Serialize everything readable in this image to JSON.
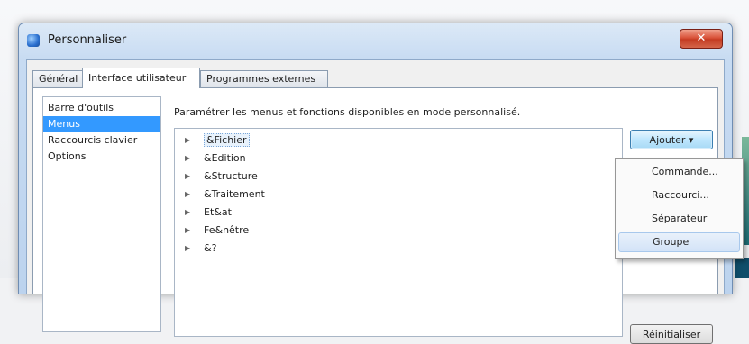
{
  "window": {
    "title": "Personnaliser",
    "close_label": "✕"
  },
  "tabs": [
    {
      "label": "Général"
    },
    {
      "label": "Interface utilisateur"
    },
    {
      "label": "Programmes externes"
    }
  ],
  "nav": {
    "items": [
      {
        "label": "Barre d'outils"
      },
      {
        "label": "Menus"
      },
      {
        "label": "Raccourcis clavier"
      },
      {
        "label": "Options"
      }
    ],
    "selected": "Menus"
  },
  "content": {
    "description": "Paramétrer les menus et fonctions disponibles en mode personnalisé.",
    "tree_items": [
      {
        "label": "&Fichier"
      },
      {
        "label": "&Edition"
      },
      {
        "label": "&Structure"
      },
      {
        "label": "&Traitement"
      },
      {
        "label": "Et&at"
      },
      {
        "label": "Fe&nêtre"
      },
      {
        "label": "&?"
      }
    ]
  },
  "buttons": {
    "add_label": "Ajouter ▾",
    "reset_label": "Réinitialiser"
  },
  "dropdown": {
    "items": [
      {
        "label": "Commande..."
      },
      {
        "label": "Raccourci..."
      },
      {
        "label": "Séparateur"
      },
      {
        "label": "Groupe"
      }
    ],
    "highlighted": "Groupe"
  },
  "colors": {
    "selection": "#3399ff",
    "close_button": "#c43b22"
  }
}
